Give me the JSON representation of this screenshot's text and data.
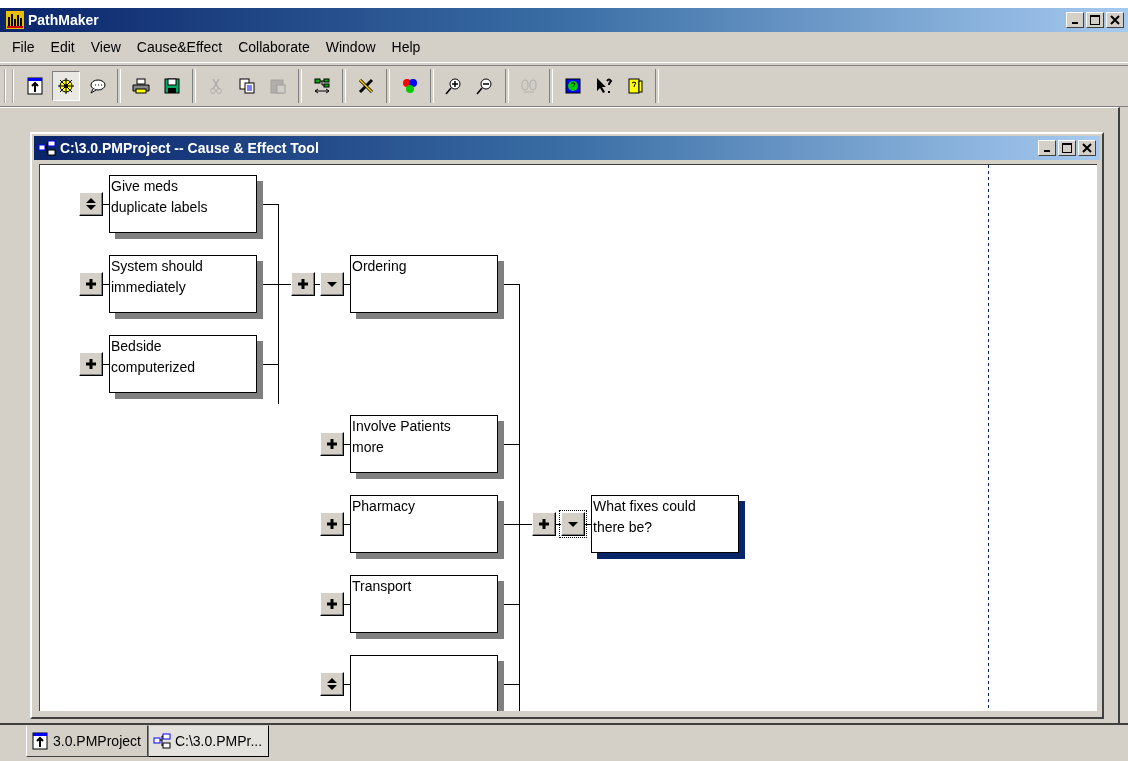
{
  "window": {
    "title": "PathMaker"
  },
  "menu": [
    "File",
    "Edit",
    "View",
    "Cause&Effect",
    "Collaborate",
    "Window",
    "Help"
  ],
  "toolbar": {
    "groups": [
      {
        "buttons": [
          {
            "selected": false,
            "disabled": false
          },
          {
            "selected": true,
            "disabled": false
          },
          {
            "selected": false,
            "disabled": false
          }
        ]
      },
      {
        "buttons": [
          {
            "selected": false,
            "disabled": false
          },
          {
            "selected": false,
            "disabled": false
          }
        ]
      },
      {
        "buttons": [
          {
            "selected": false,
            "disabled": true
          },
          {
            "selected": false,
            "disabled": false
          },
          {
            "selected": false,
            "disabled": true
          }
        ]
      },
      {
        "buttons": [
          {
            "selected": false,
            "disabled": false
          }
        ]
      },
      {
        "buttons": [
          {
            "selected": false,
            "disabled": false
          }
        ]
      },
      {
        "buttons": [
          {
            "selected": false,
            "disabled": false
          }
        ]
      },
      {
        "buttons": [
          {
            "selected": false,
            "disabled": false
          },
          {
            "selected": false,
            "disabled": false
          }
        ]
      },
      {
        "buttons": [
          {
            "selected": false,
            "disabled": true
          }
        ]
      },
      {
        "buttons": [
          {
            "selected": false,
            "disabled": false
          },
          {
            "selected": false,
            "disabled": false
          },
          {
            "selected": false,
            "disabled": false
          }
        ]
      }
    ]
  },
  "child_window": {
    "title": "C:\\3.0.PMProject -- Cause & Effect Tool"
  },
  "diagram": {
    "root": {
      "text": "What fixes could\nthere be?",
      "selected": true,
      "kind": "plus",
      "collapse_focused": true,
      "children": [
        {
          "text": "Ordering",
          "selected": false,
          "kind": "plus",
          "collapse_focused": false,
          "children": [
            {
              "text": "Give meds\nduplicate labels",
              "selected": false,
              "kind": "updown"
            },
            {
              "text": "System should\nimmediately",
              "selected": false,
              "kind": "plus"
            },
            {
              "text": "Bedside\ncomputerized",
              "selected": false,
              "kind": "plus"
            }
          ]
        },
        {
          "text": "Involve Patients\nmore",
          "selected": false,
          "kind": "plus"
        },
        {
          "text": "Pharmacy",
          "selected": false,
          "kind": "plus"
        },
        {
          "text": "Transport",
          "selected": false,
          "kind": "plus"
        },
        {
          "selected": false,
          "kind": "updown"
        }
      ]
    }
  },
  "tabs": [
    {
      "label": "3.0.PMProject",
      "selected": false
    },
    {
      "label": "C:\\3.0.PMPr...",
      "selected": true
    }
  ]
}
